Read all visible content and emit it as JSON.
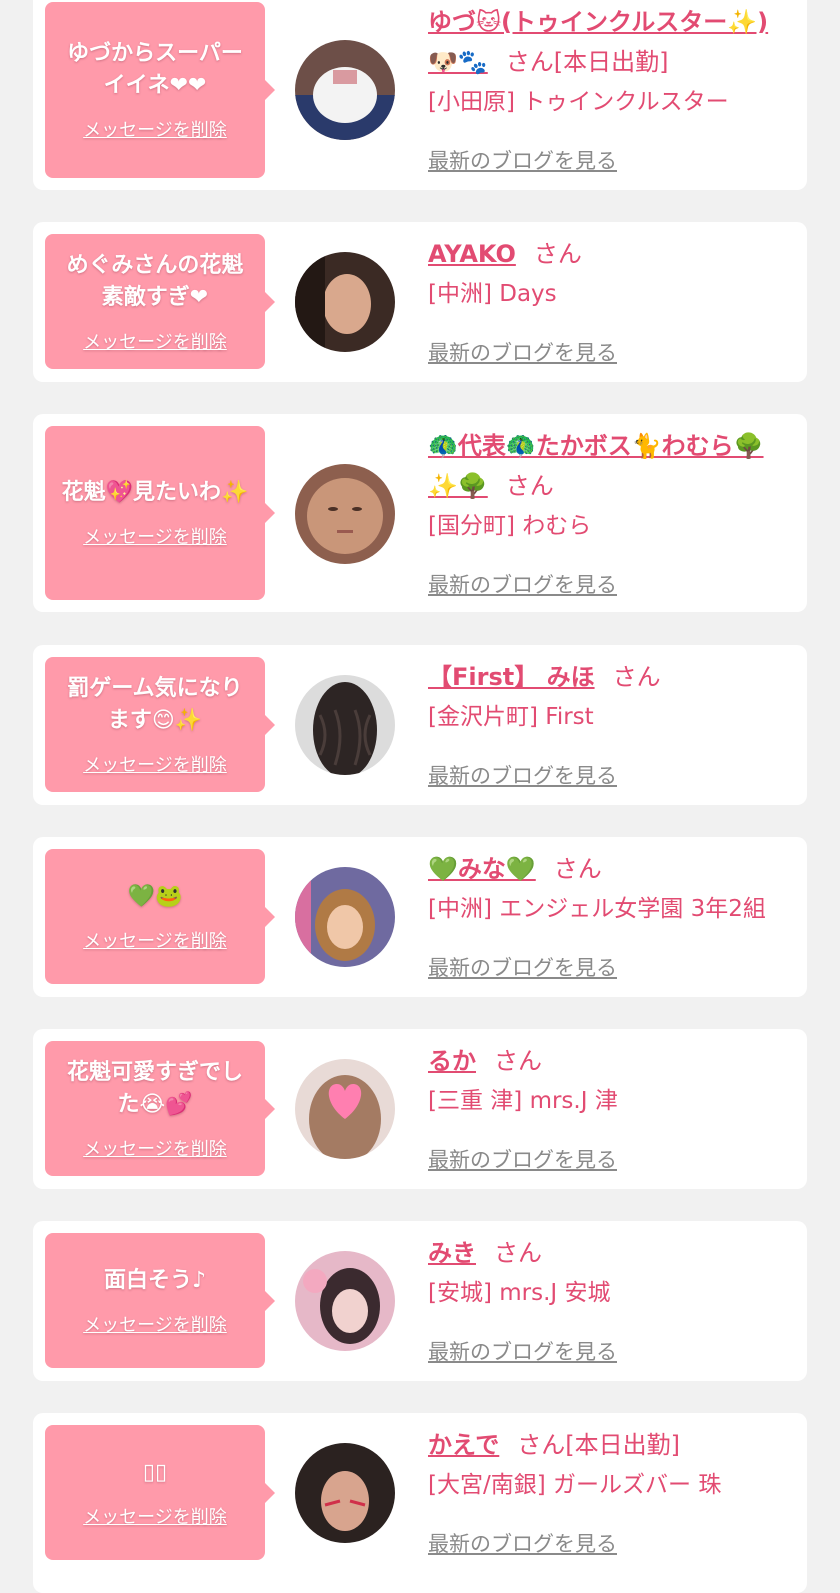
{
  "delete_label": "メッセージを削除",
  "blog_label": "最新のブログを見る",
  "cards": [
    {
      "msg_line1": "ゆづからスーパー",
      "msg_line2": "イイネ❤❤",
      "name": "ゆづ🐱(トゥインクルスター✨)",
      "name_line2": "🐶🐾",
      "san": "さん[本日出勤]",
      "shop": "[小田原] トゥインクルスター"
    },
    {
      "msg_line1": "めぐみさんの花魁",
      "msg_line2": "素敵すぎ❤",
      "name": "AYAKO",
      "san": "さん",
      "shop": "[中洲] Days"
    },
    {
      "msg_line1": "花魁💖見たいわ✨",
      "name": "🦚代表🦚たかボス🐈わむら🌳",
      "name_line2": "✨🌳",
      "san": "さん",
      "shop": "[国分町] わむら"
    },
    {
      "msg_line1": "罰ゲーム気になり",
      "msg_line2": "ます😊✨",
      "name": "【First】 みほ",
      "san": "さん",
      "shop": "[金沢片町] First"
    },
    {
      "msg_line1": "💚🐸",
      "name": "💚みな💚",
      "san": "さん",
      "shop": "[中洲] エンジェル女学園 3年2組"
    },
    {
      "msg_line1": "花魁可愛すぎでし",
      "msg_line2": "た😭💕",
      "name": "るか",
      "san": "さん",
      "shop": "[三重 津] mrs.J 津"
    },
    {
      "msg_line1": "面白そう♪",
      "name": "みき",
      "san": "さん",
      "shop": "[安城] mrs.J 安城"
    },
    {
      "msg_line1": "▯▯",
      "name": "かえで",
      "san": "さん[本日出勤]",
      "shop": "[大宮/南銀] ガールズバー 珠"
    }
  ],
  "colors": {
    "accent": "#e24b72",
    "message_bg": "#ff9aaa",
    "link_gray": "#8a8a8a",
    "page_bg": "#f1f1f1"
  }
}
